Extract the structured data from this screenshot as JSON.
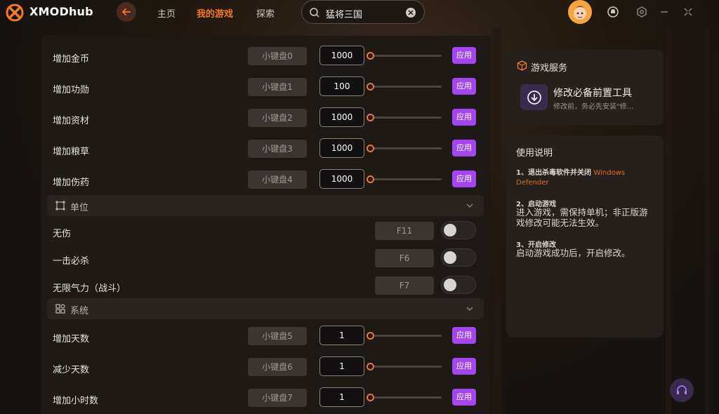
{
  "app": {
    "brand": "XMODhub"
  },
  "nav": {
    "home": "主页",
    "my_games": "我的游戏",
    "explore": "探索"
  },
  "search": {
    "value": "猛将三国"
  },
  "colors": {
    "accent": "#f07a2a",
    "apply": "#a146f0",
    "slider": "#e4793a"
  },
  "resources": [
    {
      "label": "增加金币",
      "hotkey": "小键盘0",
      "value": "1000",
      "apply": "应用"
    },
    {
      "label": "增加功勋",
      "hotkey": "小键盘1",
      "value": "100",
      "apply": "应用"
    },
    {
      "label": "增加资材",
      "hotkey": "小键盘2",
      "value": "1000",
      "apply": "应用"
    },
    {
      "label": "增加粮草",
      "hotkey": "小键盘3",
      "value": "1000",
      "apply": "应用"
    },
    {
      "label": "增加伤药",
      "hotkey": "小键盘4",
      "value": "1000",
      "apply": "应用"
    }
  ],
  "unit_section": {
    "title": "单位"
  },
  "unit_toggles": [
    {
      "label": "无伤",
      "hotkey": "F11"
    },
    {
      "label": "一击必杀",
      "hotkey": "F6"
    },
    {
      "label": "无限气力（战斗）",
      "hotkey": "F7"
    }
  ],
  "system_section": {
    "title": "系统"
  },
  "system": [
    {
      "label": "增加天数",
      "hotkey": "小键盘5",
      "value": "1",
      "apply": "应用"
    },
    {
      "label": "减少天数",
      "hotkey": "小键盘6",
      "value": "1",
      "apply": "应用"
    },
    {
      "label": "增加小时数",
      "hotkey": "小键盘7",
      "value": "1",
      "apply": "应用"
    }
  ],
  "service": {
    "title": "游戏服务",
    "tool_title": "修改必备前置工具",
    "tool_sub": "修改前，务必先安装\"修..."
  },
  "guide": {
    "title": "使用说明",
    "step1_head": "1、退出杀毒软件并关闭",
    "step1_accent": "Windows Defender",
    "step2_head": "2、启动游戏",
    "step2_text": "进入游戏，需保持单机；非正版游戏修改可能无法生效。",
    "step3_head": "3、开启修改",
    "step3_text": "启动游戏成功后，开启修改。"
  }
}
